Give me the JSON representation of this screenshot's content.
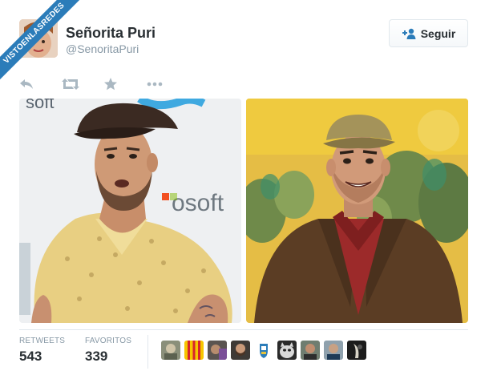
{
  "watermark": {
    "text": "VISTOENLASREDES"
  },
  "author": {
    "name": "Señorita Puri",
    "handle": "@SenoritaPuri"
  },
  "follow": {
    "label": "Seguir",
    "icon": "add-user-icon"
  },
  "actions": [
    {
      "name": "reply",
      "icon": "reply-icon"
    },
    {
      "name": "retweet",
      "icon": "retweet-icon"
    },
    {
      "name": "favorite",
      "icon": "star-icon"
    },
    {
      "name": "more",
      "icon": "more-icon"
    }
  ],
  "media": {
    "left": {
      "logo_text_top": "soft",
      "logo_text_mid": "osoft"
    },
    "right": {}
  },
  "stats": {
    "retweets": {
      "label": "RETWEETS",
      "value": "543"
    },
    "favorites": {
      "label": "FAVORITOS",
      "value": "339"
    }
  },
  "colors": {
    "accent": "#2b7cb9",
    "text": "#292f33",
    "muted": "#8899a6",
    "border": "#e1e8ed"
  }
}
